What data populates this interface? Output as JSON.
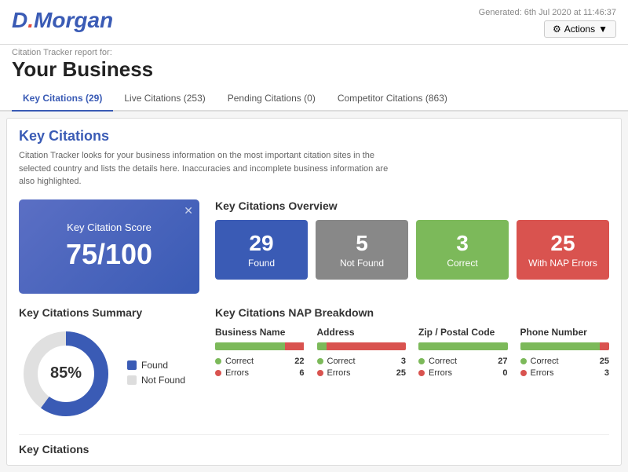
{
  "logo": {
    "d": "D",
    "dot": ".",
    "morgan": "Morgan"
  },
  "report": {
    "label": "Citation Tracker report for:",
    "business_name": "Your Business",
    "generated": "Generated: 6th Jul 2020 at 11:46:37",
    "actions_label": "Actions"
  },
  "tabs": [
    {
      "label": "Key Citations (29)",
      "active": true
    },
    {
      "label": "Live Citations (253)",
      "active": false
    },
    {
      "label": "Pending Citations (0)",
      "active": false
    },
    {
      "label": "Competitor Citations (863)",
      "active": false
    }
  ],
  "section": {
    "title": "Key Citations",
    "description": "Citation Tracker looks for your business information on the most important citation sites in the selected country and lists the details here. Inaccuracies and incomplete business information are also highlighted."
  },
  "score_box": {
    "label": "Key Citation Score",
    "value": "75/100"
  },
  "overview": {
    "title": "Key Citations Overview",
    "cards": [
      {
        "num": "29",
        "label": "Found",
        "type": "found"
      },
      {
        "num": "5",
        "label": "Not Found",
        "type": "notfound"
      },
      {
        "num": "3",
        "label": "Correct",
        "type": "correct"
      },
      {
        "num": "25",
        "label": "With NAP Errors",
        "type": "errors"
      }
    ]
  },
  "summary": {
    "title": "Key Citations Summary",
    "donut": {
      "percent": 85,
      "label": "85%",
      "found_radius": 85,
      "not_found_radius": 15
    },
    "legend": [
      {
        "label": "Found",
        "type": "found"
      },
      {
        "label": "Not Found",
        "type": "notfound"
      }
    ]
  },
  "nap": {
    "title": "Key Citations NAP Breakdown",
    "columns": [
      {
        "title": "Business Name",
        "correct": 22,
        "errors": 6,
        "bar_correct_pct": 78,
        "bar_error_pct": 22
      },
      {
        "title": "Address",
        "correct": 3,
        "errors": 25,
        "bar_correct_pct": 11,
        "bar_error_pct": 89
      },
      {
        "title": "Zip / Postal Code",
        "correct": 27,
        "errors": 0,
        "bar_correct_pct": 100,
        "bar_error_pct": 0
      },
      {
        "title": "Phone Number",
        "correct": 25,
        "errors": 3,
        "bar_correct_pct": 89,
        "bar_error_pct": 11
      }
    ],
    "correct_label": "Correct",
    "errors_label": "Errors"
  },
  "bottom": {
    "label": "Key Citations"
  }
}
